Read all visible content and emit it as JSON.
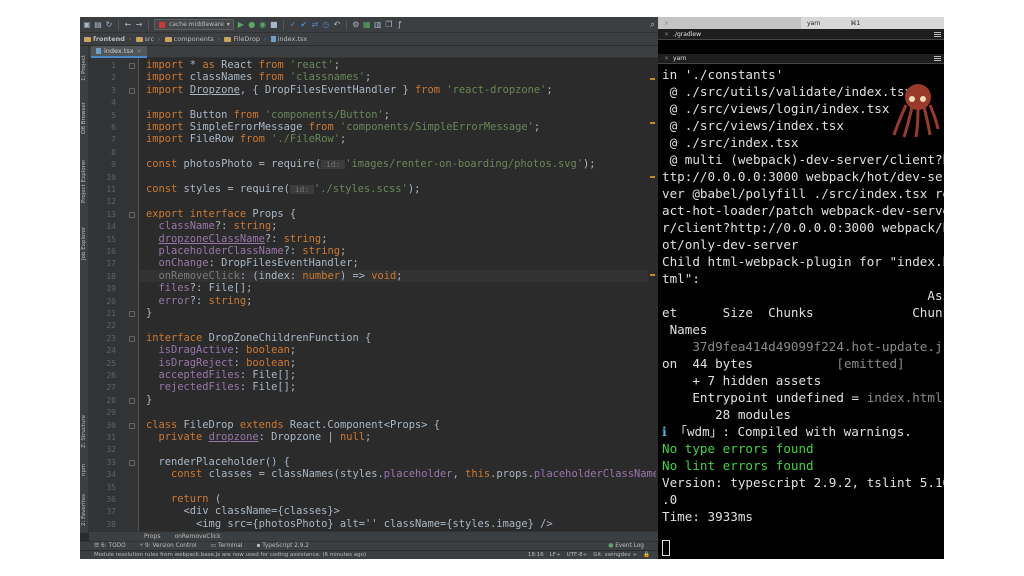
{
  "ide": {
    "toolbar": {
      "run_config": "cache middleware"
    },
    "breadcrumb": [
      "frontend",
      "src",
      "components",
      "FileDrop",
      "index.tsx"
    ],
    "file_tab": "index.tsx",
    "side_tabs_top": [
      "1: Project",
      "DB Browser",
      "Project Explorer",
      "Job Explorer"
    ],
    "side_tabs_bottom": [
      "Z: Structure",
      "npm",
      "2: Favorites"
    ],
    "line_numbers": [
      "1",
      "2",
      "3",
      "4",
      "5",
      "6",
      "7",
      "8",
      "9",
      "10",
      "11",
      "12",
      "13",
      "14",
      "15",
      "16",
      "17",
      "18",
      "19",
      "20",
      "21",
      "22",
      "23",
      "24",
      "25",
      "26",
      "27",
      "28",
      "29",
      "30",
      "31",
      "32",
      "33",
      "34",
      "35",
      "36",
      "37",
      "38"
    ],
    "code": {
      "l1": {
        "kw": "import",
        "a": " * ",
        "kw2": "as",
        "b": " React ",
        "kw3": "from",
        "str": " 'react'",
        "c": ";"
      },
      "l2": {
        "kw": "import",
        "a": " classNames ",
        "kw3": "from",
        "str": " 'classnames'",
        "c": ";"
      },
      "l3": {
        "kw": "import",
        "ul": "Dropzone",
        "a": ", { DropFilesEventHandler } ",
        "kw3": "from",
        "str": " 'react-dropzone'",
        "c": ";"
      },
      "l5": {
        "kw": "import",
        "a": " Button ",
        "kw3": "from",
        "str": " 'components/Button'",
        "c": ";"
      },
      "l6": {
        "kw": "import",
        "a": " SimpleErrorMessage ",
        "kw3": "from",
        "str": " 'components/SimpleErrorMessage'",
        "c": ";"
      },
      "l7": {
        "kw": "import",
        "a": " FileRow ",
        "kw3": "from",
        "str": " './FileRow'",
        "c": ";"
      },
      "l9": {
        "kw": "const",
        "a": " photosPhoto = require(",
        "hint": " id: ",
        "str": "'images/renter-on-boarding/photos.svg'",
        "c": ");"
      },
      "l11": {
        "kw": "const",
        "a": " styles = require(",
        "hint": " id: ",
        "str": "'./styles.scss'",
        "c": ");"
      },
      "l13": {
        "kw": "export interface",
        "a": " Props {"
      },
      "l14": {
        "prop": "className",
        "a": "?: ",
        "type": "string",
        "c": ";"
      },
      "l15": {
        "prop": "dropzoneClassName",
        "a": "?: ",
        "type": "string",
        "c": ";"
      },
      "l16": {
        "prop": "placeholderClassName",
        "a": "?: ",
        "type": "string",
        "c": ";"
      },
      "l17": {
        "prop": "onChange",
        "a": ": DropFilesEventHandler;"
      },
      "l18": {
        "prop": "onRemoveClick",
        "a": ": (",
        "param": "index",
        "b": ": ",
        "type": "number",
        "c": ") => ",
        "type2": "void",
        "d": ";"
      },
      "l19": {
        "prop": "files",
        "a": "?: File[];"
      },
      "l20": {
        "prop": "error",
        "a": "?: ",
        "type": "string",
        "c": ";"
      },
      "l21": {
        "a": "}"
      },
      "l23": {
        "kw": "interface",
        "a": " DropZoneChildrenFunction {"
      },
      "l24": {
        "prop": "isDragActive",
        "a": ": ",
        "type": "boolean",
        "c": ";"
      },
      "l25": {
        "prop": "isDragReject",
        "a": ": ",
        "type": "boolean",
        "c": ";"
      },
      "l26": {
        "prop": "acceptedFiles",
        "a": ": File[];"
      },
      "l27": {
        "prop": "rejectedFiles",
        "a": ": File[];"
      },
      "l28": {
        "a": "}"
      },
      "l30": {
        "kw": "class",
        "a": " FileDrop ",
        "kw2": "extends",
        "b": " React.Component<Props> {"
      },
      "l31": {
        "kw": "private",
        "ul": "dropzone",
        "a": ": Dropzone | ",
        "kw2": "null",
        "c": ";"
      },
      "l33": {
        "a": "renderPlaceholder() {"
      },
      "l34": {
        "kw": "const",
        "a": " classes = classNames(styles.",
        "prop": "placeholder",
        "b": ", ",
        "kw2": "this",
        "c": ".props.",
        "prop2": "placeholderClassName",
        "d": ");"
      },
      "l36": {
        "kw": "return",
        "a": " ("
      },
      "l37": {
        "a": "<div className={classes}>"
      },
      "l38": {
        "a": "<img src={photosPhoto} alt='' className={styles.image} />"
      }
    },
    "structure_bar": [
      "Props",
      "onRemoveClick"
    ],
    "tool_windows": [
      "6: TODO",
      "9: Version Control",
      "Terminal",
      "TypeScript 2.9.2"
    ],
    "event_log": "Event Log",
    "status_message": "Module resolution rules from webpack.base.js are now used for coding assistance. (6 minutes ago)",
    "status_right": [
      "18:16",
      "LF÷",
      "UTF-8÷",
      "Git: swingdev ÷"
    ]
  },
  "terminal": {
    "tabs": [
      {
        "label": "yarn",
        "shortcut": "⌘1"
      }
    ],
    "pane1_title": "./gradlew",
    "pane2_title": "yarn",
    "lines": [
      {
        "text": "in './constants'",
        "style": "normal"
      },
      {
        "text": " @ ./src/utils/validate/index.tsx",
        "style": "normal"
      },
      {
        "text": " @ ./src/views/login/index.tsx",
        "style": "normal"
      },
      {
        "text": " @ ./src/views/index.tsx",
        "style": "normal"
      },
      {
        "text": " @ ./src/index.tsx",
        "style": "normal"
      },
      {
        "text": " @ multi (webpack)-dev-server/client?h",
        "style": "normal"
      },
      {
        "text": "ttp://0.0.0.0:3000 webpack/hot/dev-ser",
        "style": "normal"
      },
      {
        "text": "ver @babel/polyfill ./src/index.tsx re",
        "style": "normal"
      },
      {
        "text": "act-hot-loader/patch webpack-dev-serve",
        "style": "normal"
      },
      {
        "text": "r/client?http://0.0.0.0:3000 webpack/h",
        "style": "normal"
      },
      {
        "text": "ot/only-dev-server",
        "style": "normal"
      },
      {
        "text": "Child html-webpack-plugin for \"index.h",
        "style": "normal"
      },
      {
        "text": "tml\":",
        "style": "normal"
      },
      {
        "text": "                                   Ass",
        "style": "normal"
      },
      {
        "text": "et      Size  Chunks             Chunk",
        "style": "normal"
      },
      {
        "text": " Names",
        "style": "normal"
      }
    ],
    "asset_line_1": "    37d9fea414d49099f224.hot-update.js",
    "asset_line_2_a": "on  44 bytes           ",
    "asset_line_2_b": "[emitted]",
    "hidden_assets": "    + 7 hidden assets",
    "entrypoint_a": "    Entrypoint undefined = ",
    "entrypoint_b": "index.html",
    "modules": "       28 modules",
    "wdm_icon": "ℹ",
    "wdm_text": " 「wdm」: Compiled with warnings.",
    "no_type_errors": "No type errors found",
    "no_lint_errors": "No lint errors found",
    "version_1": "Version: typescript 2.9.2, tslint 5.10",
    "version_2": ".0",
    "time": "Time: 3933ms"
  }
}
